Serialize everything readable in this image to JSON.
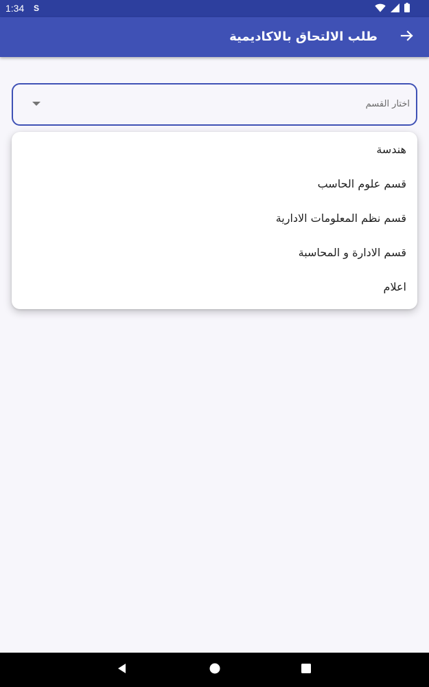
{
  "status_bar": {
    "time": "1:34",
    "left_icon": "S",
    "icons": [
      "wifi-icon",
      "signal-icon",
      "battery-icon"
    ]
  },
  "app_bar": {
    "title": "طلب الالتحاق بالاكاديمية",
    "back_icon": "arrow-right-icon"
  },
  "department_dropdown": {
    "placeholder": "اختار القسم",
    "caret_icon": "caret-down-icon",
    "options": [
      "هندسة",
      "قسم علوم الحاسب",
      "قسم نظم المعلومات الادارية",
      "قسم الادارة و المحاسبة",
      "اعلام"
    ]
  },
  "navigation_bar": {
    "buttons": [
      "back-triangle-icon",
      "home-circle-icon",
      "recents-square-icon"
    ]
  },
  "colors": {
    "status_bar": "#2d3f9e",
    "app_bar": "#3f51b5",
    "background": "#f7f6fb",
    "field_border": "#3f51b5",
    "nav_bar": "#000000"
  }
}
